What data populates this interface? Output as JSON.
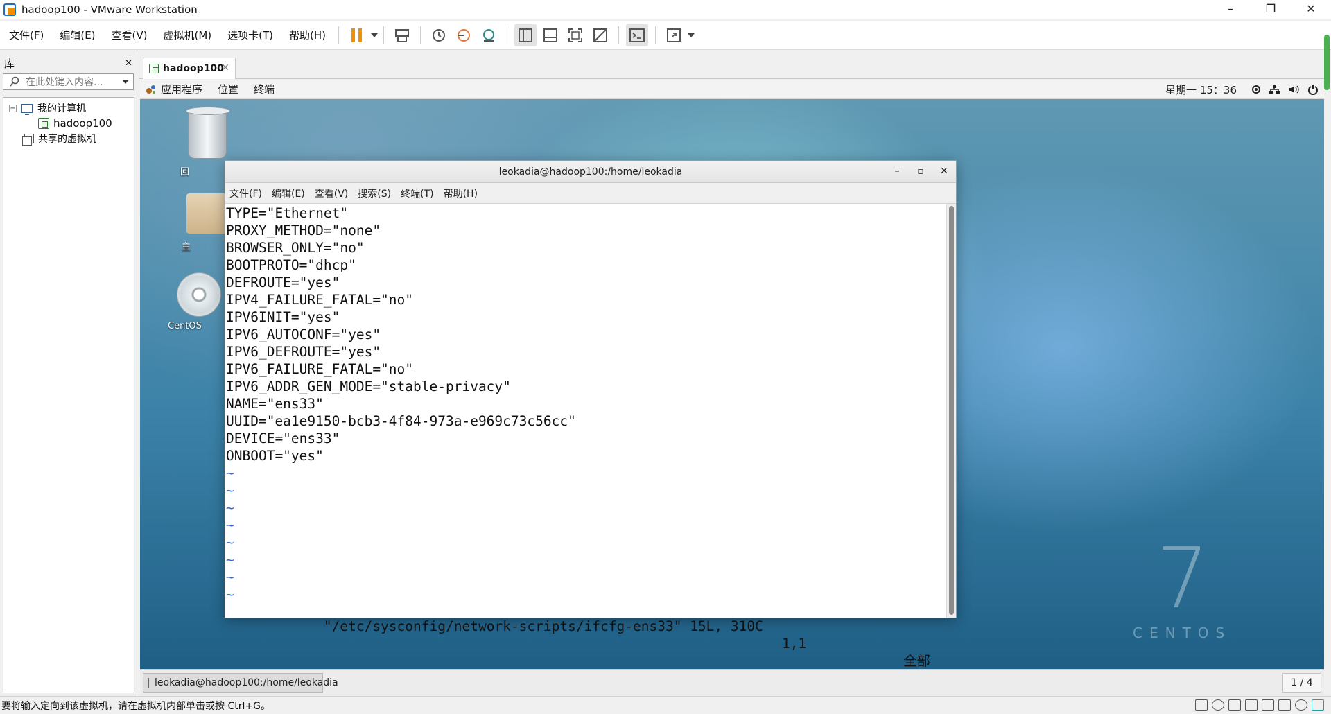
{
  "window": {
    "title": "hadoop100 - VMware Workstation",
    "minimize": "–",
    "restore": "❐",
    "close": "✕"
  },
  "menubar": {
    "items": [
      "文件(F)",
      "编辑(E)",
      "查看(V)",
      "虚拟机(M)",
      "选项卡(T)",
      "帮助(H)"
    ]
  },
  "library": {
    "title": "库",
    "close": "✕",
    "search_placeholder": "在此处键入内容...",
    "tree": {
      "my_computer": "我的计算机",
      "vm": "hadoop100",
      "shared": "共享的虚拟机"
    }
  },
  "tab": {
    "label": "hadoop100",
    "close": "✕"
  },
  "guest_top": {
    "apps": "应用程序",
    "places": "位置",
    "terminal": "终端",
    "clock": "星期一 15：36"
  },
  "desktop": {
    "trash_label": "回",
    "home_label": "主",
    "disc_label": "CentOS"
  },
  "centos": {
    "seven": "7",
    "word": "CENTOS"
  },
  "terminal": {
    "title": "leokadia@hadoop100:/home/leokadia",
    "minimize": "–",
    "maximize": "▫",
    "close": "✕",
    "menu": [
      "文件(F)",
      "编辑(E)",
      "查看(V)",
      "搜索(S)",
      "终端(T)",
      "帮助(H)"
    ],
    "lines": [
      "TYPE=\"Ethernet\"",
      "PROXY_METHOD=\"none\"",
      "BROWSER_ONLY=\"no\"",
      "BOOTPROTO=\"dhcp\"",
      "DEFROUTE=\"yes\"",
      "IPV4_FAILURE_FATAL=\"no\"",
      "IPV6INIT=\"yes\"",
      "IPV6_AUTOCONF=\"yes\"",
      "IPV6_DEFROUTE=\"yes\"",
      "IPV6_FAILURE_FATAL=\"no\"",
      "IPV6_ADDR_GEN_MODE=\"stable-privacy\"",
      "NAME=\"ens33\"",
      "UUID=\"ea1e9150-bcb3-4f84-973a-e969c73c56cc\"",
      "DEVICE=\"ens33\"",
      "ONBOOT=\"yes\"",
      "~",
      "~",
      "~",
      "~",
      "~",
      "~",
      "~",
      "~"
    ],
    "status_file": "\"/etc/sysconfig/network-scripts/ifcfg-ens33\" 15L, 310C",
    "status_pos": "1,1",
    "status_all": "全部"
  },
  "taskbar": {
    "item": "leokadia@hadoop100:/home/leokadia",
    "workspace": "1 / 4"
  },
  "statusbar": {
    "text": "要将输入定向到该虚拟机，请在虚拟机内部单击或按 Ctrl+G。"
  }
}
